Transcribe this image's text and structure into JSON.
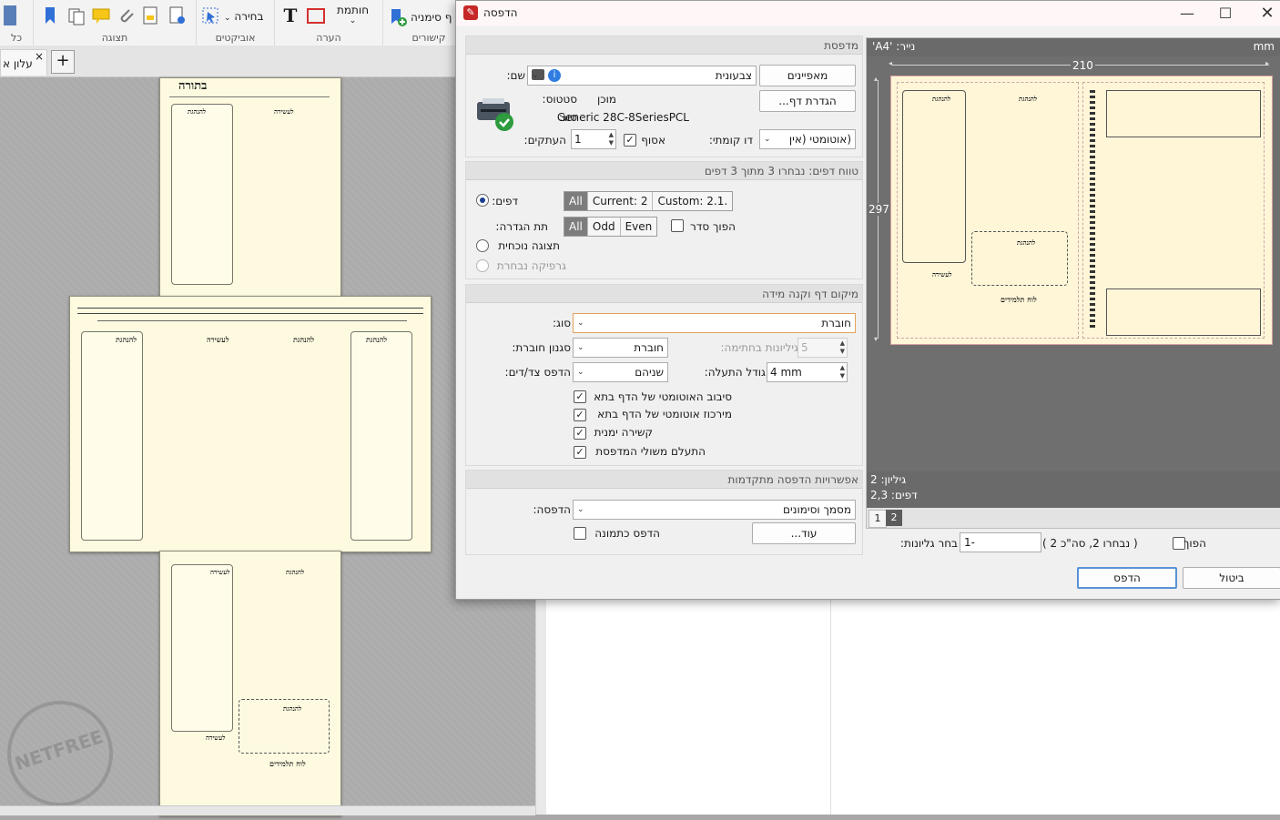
{
  "app": {
    "ribbon_groups": [
      {
        "label": "כל"
      },
      {
        "label": "תצוגה"
      },
      {
        "label": "אוביקטים",
        "button": "בחירה"
      },
      {
        "label": "הערה",
        "button": "חותמת"
      },
      {
        "label": "קישורים",
        "button": "ף סימניה"
      }
    ],
    "doc_tab": "עלון א",
    "doc_tab_close": "×",
    "add_tab": "+"
  },
  "dialog": {
    "title": "הדפסה",
    "printer": {
      "header": "מדפסת",
      "name_label": "שם:",
      "name_value": "צבעונית",
      "properties_button": "מאפיינים",
      "page_setup_button": "הגדרת דף...",
      "status_label": "סטטוס:",
      "status_value": "מוכן",
      "type_label": "סוג:",
      "type_value": "Generic 28C-8SeriesPCL",
      "copies_label": "העתקים:",
      "copies_value": "1",
      "collate_label": "אסוף",
      "duplex_label": "דו קומתי:",
      "duplex_value": "(אוטומטי (אין"
    },
    "range": {
      "header": "טווח דפים: נבחרו 3 מתוך 3 דפים",
      "pages_label": "דפים:",
      "pages_buttons": [
        "All",
        "Current: 2",
        "Custom: 2.1."
      ],
      "subset_label": "תת הגדרה:",
      "subset_buttons": [
        "All",
        "Odd",
        "Even"
      ],
      "reverse_label": "הפוך סדר",
      "current_view_label": "תצוגה נוכחית",
      "selected_graphic_label": "גרפיקה נבחרת"
    },
    "placement": {
      "header": "מיקום דף וקנה מידה",
      "type_label": "סוג:",
      "type_value": "חוברת",
      "booklet_style_label": "סגנון חוברת:",
      "booklet_style_value": "חוברת",
      "sheets_per_bind_label": "גיליונות בחתימה:",
      "sheets_per_bind_value": "5",
      "print_sides_label": "הדפס צד/דים:",
      "print_sides_value": "שניהם",
      "gutter_label": "גודל התעלה:",
      "gutter_value": "4 mm",
      "options": [
        {
          "label": "סיבוב האוטומטי של הדף בתא",
          "checked": true
        },
        {
          "label": "מירכוז אוטומטי של הדף בתא",
          "checked": true
        },
        {
          "label": "קשירה ימנית",
          "checked": true
        },
        {
          "label": "התעלם משולי המדפסת",
          "checked": true
        }
      ]
    },
    "advanced": {
      "header": "אפשרויות הדפסה מתקדמות",
      "print_label": "הדפסה:",
      "print_value": "מסמך וסימונים",
      "print_as_image_label": "הדפס כתמונה",
      "more_button": "עוד..."
    },
    "preview": {
      "paper_label": "נייר: 'A4'",
      "units": "mm",
      "width": "210",
      "height": "297",
      "sheets_label": "גיליון: 2",
      "pages_label": "דפים: 2,3",
      "tabs": [
        "1",
        "2"
      ]
    },
    "sheet_select": {
      "reverse_label": "הפוך",
      "summary": "( נבחרו 2,  סה\"כ 2 )",
      "select_label": "בחר גליונות:",
      "select_value": "1-"
    },
    "print_button": "הדפס",
    "cancel_button": "ביטול"
  },
  "page_text": {
    "heading": "להנהגת",
    "small_heading": "לעשירה",
    "footer": "לוח תלמידים",
    "banner": "בתורה"
  },
  "watermark": "NETFREE"
}
